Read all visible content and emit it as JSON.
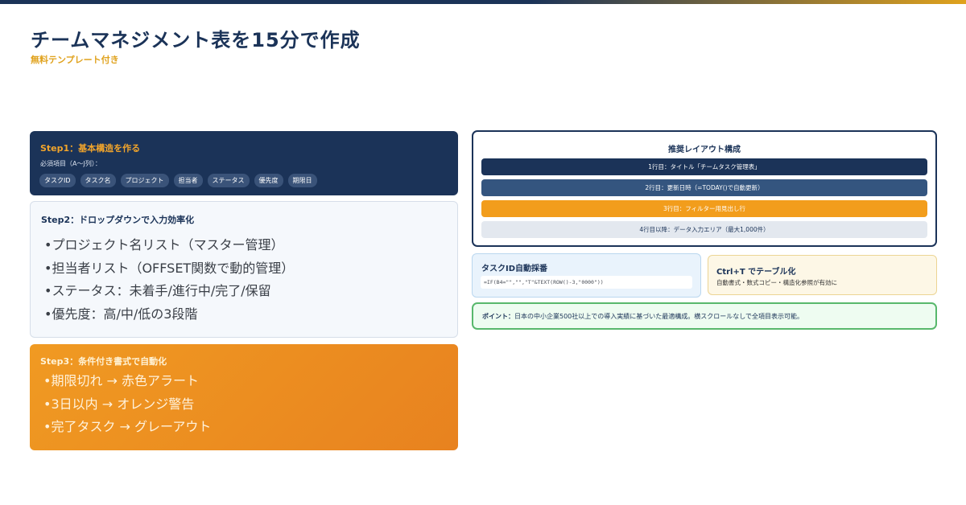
{
  "header": {
    "title": "チームマネジメント表を15分で作成",
    "subtitle": "無料テンプレート付き"
  },
  "step1": {
    "title": "Step1：基本構造を作る",
    "required_label": "必須項目（A〜J列）：",
    "chips": [
      "タスクID",
      "タスク名",
      "プロジェクト",
      "担当者",
      "ステータス",
      "優先度",
      "期限日"
    ]
  },
  "step2": {
    "title": "Step2：ドロップダウンで入力効率化",
    "items": [
      "•プロジェクト名リスト（マスター管理）",
      "•担当者リスト（OFFSET関数で動的管理）",
      "•ステータス：未着手/進行中/完了/保留",
      "•優先度：高/中/低の3段階"
    ]
  },
  "step3": {
    "title": "Step3：条件付き書式で自動化",
    "items": [
      "•期限切れ → 赤色アラート",
      "•3日以内 → オレンジ警告",
      "•完了タスク → グレーアウト"
    ]
  },
  "layout": {
    "title": "推奨レイアウト構成",
    "rows": [
      "1行目：タイトル「チームタスク管理表」",
      "2行目：更新日時（=TODAY()で自動更新）",
      "3行目：フィルター用見出し行",
      "4行目以降：データ入力エリア（最大1,000件）"
    ]
  },
  "taskid": {
    "title": "タスクID自動採番",
    "formula": "=IF(B4=\"\",\"\",\"T\"&TEXT(ROW()-3,\"0000\"))"
  },
  "ctrlt": {
    "title": "Ctrl+T でテーブル化",
    "desc": "自動書式・数式コピー・構造化参照が有効に"
  },
  "point": {
    "label": "ポイント：",
    "text": "日本の中小企業500社以上での導入実績に基づいた最適構成。横スクロールなしで全項目表示可能。"
  },
  "colors": {
    "navy": "#1b3358",
    "orange": "#f29d1c",
    "green": "#58b86c"
  }
}
